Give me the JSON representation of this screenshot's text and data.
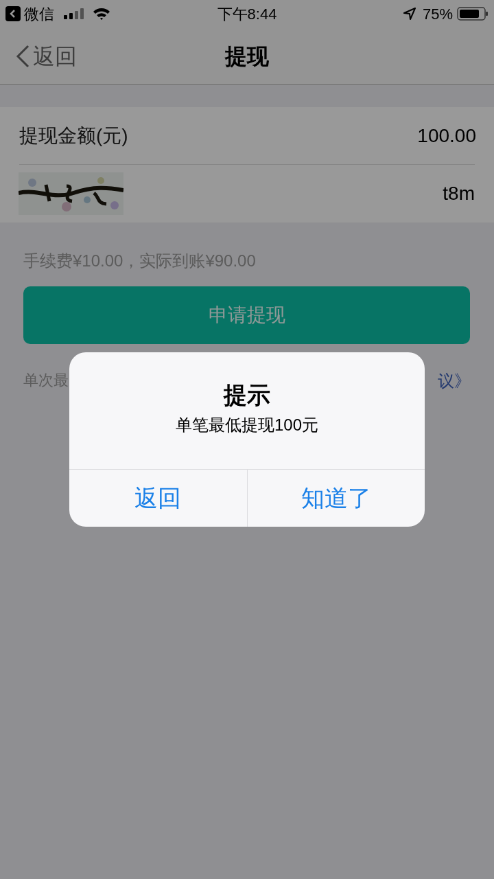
{
  "status_bar": {
    "back_app": "微信",
    "time": "下午8:44",
    "battery": "75%"
  },
  "nav": {
    "back": "返回",
    "title": "提现"
  },
  "form": {
    "amount_label": "提现金额(元)",
    "amount_value": "100.00",
    "captcha_value": "t8m"
  },
  "fee_note": "手续费¥10.00，实际到账¥90.00",
  "submit_button": "申请提现",
  "limit_note_start": "单次最",
  "limit_note_end": "议》",
  "dialog": {
    "title": "提示",
    "message": "单笔最低提现100元",
    "buttons": [
      "返回",
      "知道了"
    ]
  }
}
